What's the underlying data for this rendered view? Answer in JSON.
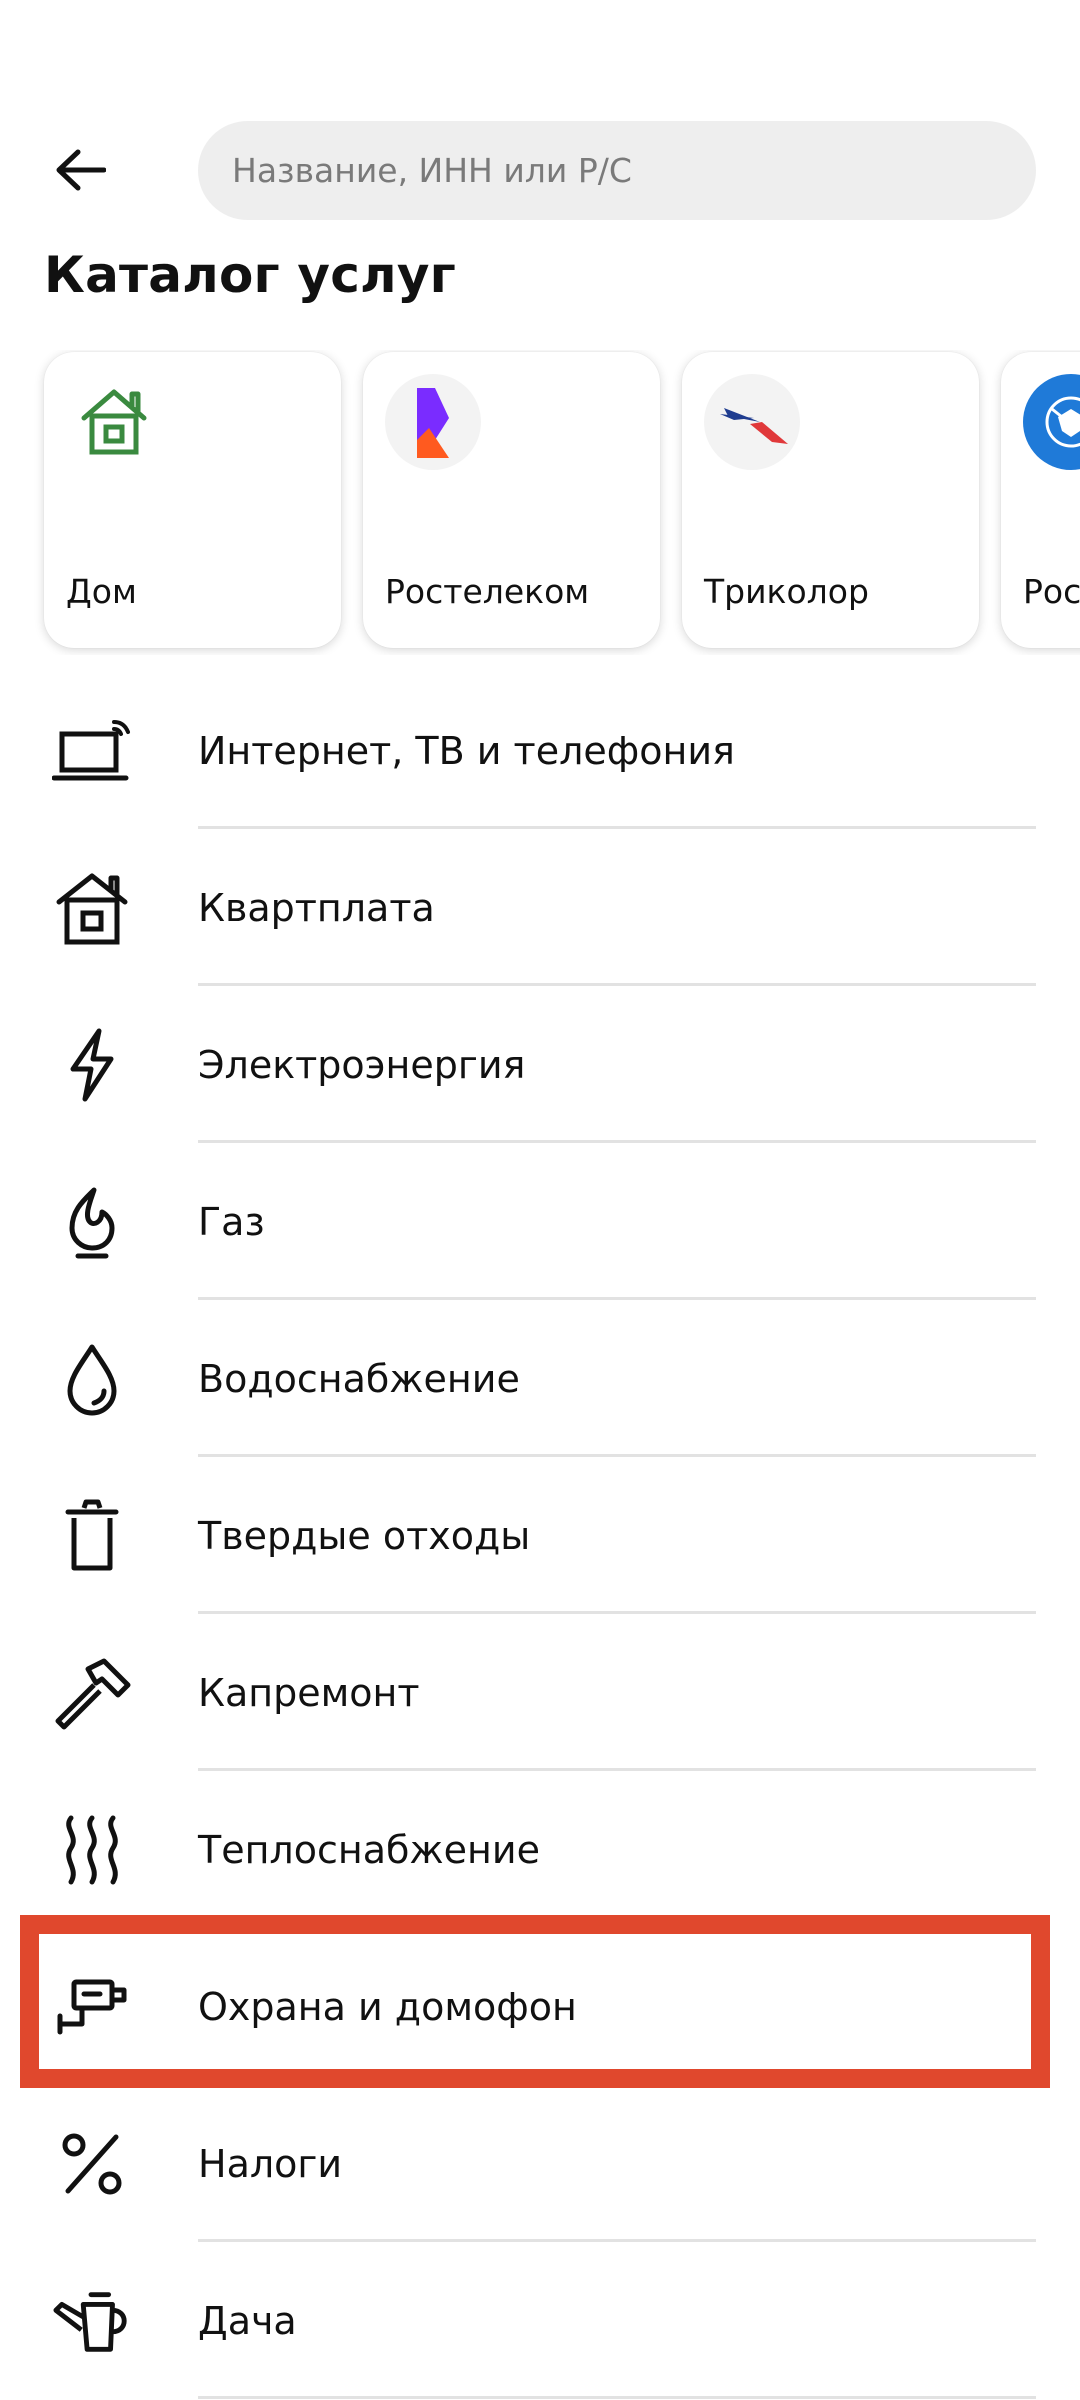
{
  "header": {
    "search_placeholder": "Название, ИНН или Р/С",
    "title": "Каталог услуг"
  },
  "cards": [
    {
      "label": "Дом",
      "logo": "house-logo"
    },
    {
      "label": "Ростелеком",
      "logo": "rostelecom-logo"
    },
    {
      "label": "Триколор",
      "logo": "tricolor-logo"
    },
    {
      "label": "Рос",
      "logo": "emblem-logo"
    }
  ],
  "list": [
    {
      "label": "Интернет, ТВ и телефония",
      "icon": "laptop-wifi-icon"
    },
    {
      "label": "Квартплата",
      "icon": "house-icon"
    },
    {
      "label": "Электроэнергия",
      "icon": "lightning-icon"
    },
    {
      "label": "Газ",
      "icon": "flame-icon"
    },
    {
      "label": "Водоснабжение",
      "icon": "water-drop-icon"
    },
    {
      "label": "Твердые отходы",
      "icon": "trash-bin-icon"
    },
    {
      "label": "Капремонт",
      "icon": "hammer-icon"
    },
    {
      "label": "Теплоснабжение",
      "icon": "heat-waves-icon"
    },
    {
      "label": "Охрана и домофон",
      "icon": "security-camera-icon"
    },
    {
      "label": "Налоги",
      "icon": "percent-icon"
    },
    {
      "label": "Дача",
      "icon": "watering-can-icon"
    }
  ],
  "colors": {
    "highlight": "#e0482d",
    "card_green": "#3a8a3f",
    "rostelecom_purple": "#7a2cff",
    "rostelecom_orange": "#ff5a1f",
    "tricolor_blue": "#1f3c8f",
    "tricolor_red": "#e0383a"
  }
}
